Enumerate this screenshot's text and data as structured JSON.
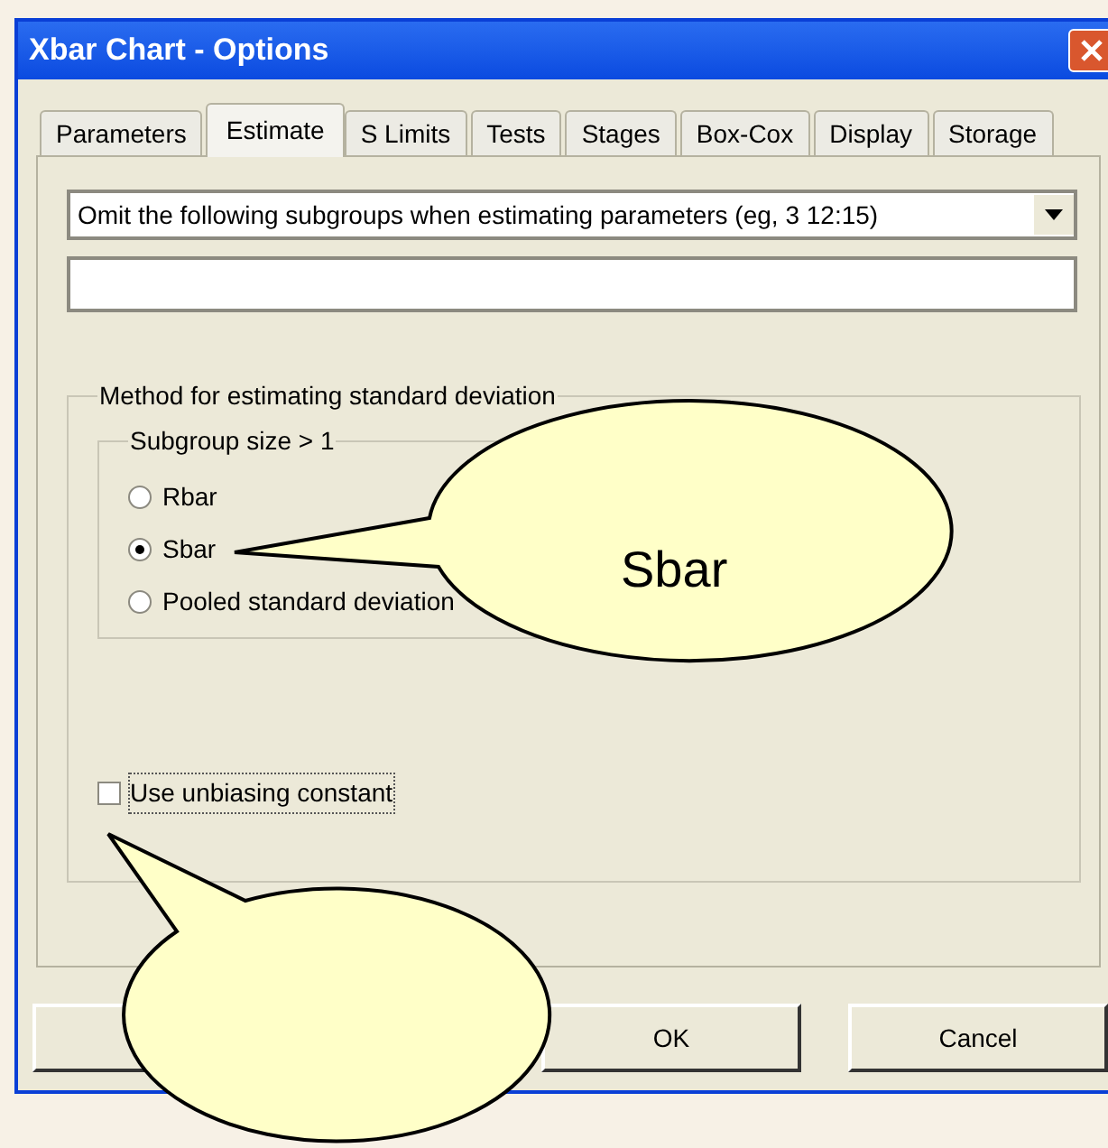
{
  "window": {
    "title": "Xbar Chart - Options"
  },
  "tabs": [
    {
      "label": "Parameters",
      "selected": false
    },
    {
      "label": "Estimate",
      "selected": true
    },
    {
      "label": "S Limits",
      "selected": false
    },
    {
      "label": "Tests",
      "selected": false
    },
    {
      "label": "Stages",
      "selected": false
    },
    {
      "label": "Box-Cox",
      "selected": false
    },
    {
      "label": "Display",
      "selected": false
    },
    {
      "label": "Storage",
      "selected": false
    }
  ],
  "omit_dropdown": {
    "value": "Omit the following subgroups when estimating parameters (eg, 3 12:15)"
  },
  "method_group": {
    "title": "Method for estimating standard deviation",
    "subgroup_group": {
      "title": "Subgroup size > 1",
      "options": [
        {
          "label": "Rbar",
          "selected": false
        },
        {
          "label": "Sbar",
          "selected": true
        },
        {
          "label": "Pooled standard deviation",
          "selected": false
        }
      ]
    },
    "unbiasing": {
      "label": "Use unbiasing constant",
      "checked": false
    }
  },
  "buttons": [
    "OK",
    "Cancel"
  ],
  "callouts": [
    {
      "text": "Sbar"
    }
  ]
}
